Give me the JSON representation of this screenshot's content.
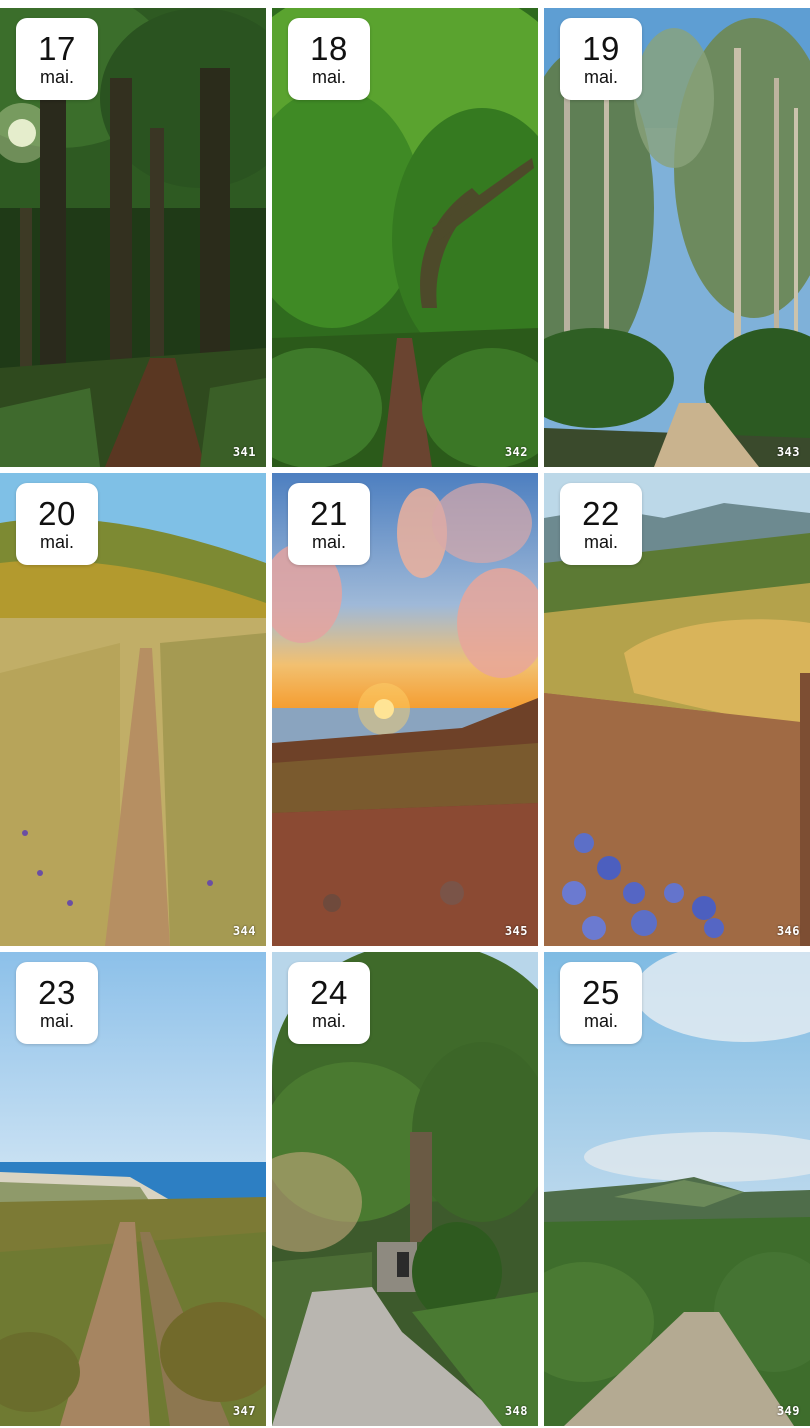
{
  "tiles": [
    {
      "day": "17",
      "month": "mai.",
      "number": "341",
      "scene": "forest-sun"
    },
    {
      "day": "18",
      "month": "mai.",
      "number": "342",
      "scene": "green-trail"
    },
    {
      "day": "19",
      "month": "mai.",
      "number": "343",
      "scene": "eucalyptus-road"
    },
    {
      "day": "20",
      "month": "mai.",
      "number": "344",
      "scene": "grass-hill-path"
    },
    {
      "day": "21",
      "month": "mai.",
      "number": "345",
      "scene": "sunset-coast"
    },
    {
      "day": "22",
      "month": "mai.",
      "number": "346",
      "scene": "dry-hill-flowers"
    },
    {
      "day": "23",
      "month": "mai.",
      "number": "347",
      "scene": "coast-trail"
    },
    {
      "day": "24",
      "month": "mai.",
      "number": "348",
      "scene": "tree-lane"
    },
    {
      "day": "25",
      "month": "mai.",
      "number": "349",
      "scene": "valley-road"
    }
  ],
  "colors": {
    "badge_background": "#ffffff",
    "badge_text": "#111111",
    "number_text": "#ffffff"
  }
}
